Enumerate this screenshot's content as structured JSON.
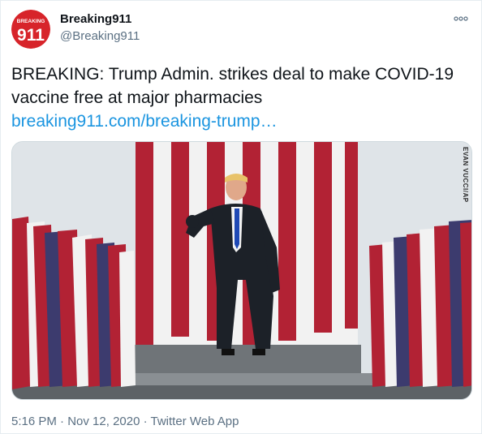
{
  "tweet": {
    "avatar": {
      "text": "911",
      "banner": "BREAKING",
      "color": "#d7242a"
    },
    "display_name": "Breaking911",
    "username": "@Breaking911",
    "more_icon": "more-horizontal-icon",
    "text": "BREAKING: Trump Admin. strikes deal to make COVID-19 vaccine free at major pharmacies",
    "link": "breaking911.com/breaking-trump…",
    "image": {
      "description_credit": "EVAN VUCCI/AP",
      "colors": {
        "sky": "#dfe4e8",
        "stripe_red": "#b22234",
        "stripe_white": "#f2f2f2",
        "canton": "#3c3b6e"
      }
    },
    "time": "5:16 PM",
    "separator": "·",
    "date": "Nov 12, 2020",
    "source": "Twitter Web App"
  }
}
